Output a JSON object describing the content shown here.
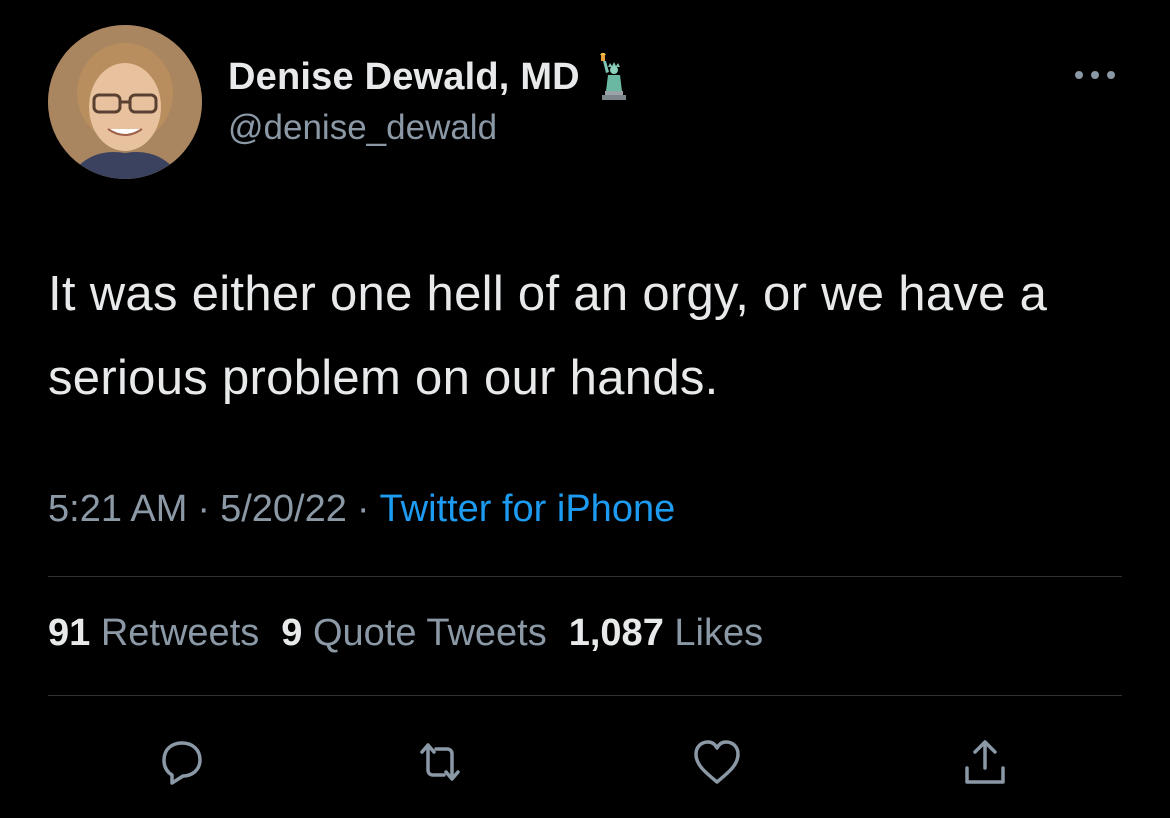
{
  "author": {
    "display_name": "Denise Dewald, MD",
    "handle": "@denise_dewald",
    "emoji_icon": "statue-of-liberty-icon",
    "avatar_icon": "profile-photo"
  },
  "tweet": {
    "text": "It was either one hell of an orgy, or we have a serious problem on our hands.",
    "time": "5:21 AM",
    "date": "5/20/22",
    "separator": "·",
    "source": "Twitter for iPhone"
  },
  "stats": {
    "retweets_count": "91",
    "retweets_label": "Retweets",
    "quotes_count": "9",
    "quotes_label": "Quote Tweets",
    "likes_count": "1,087",
    "likes_label": "Likes"
  },
  "actions": [
    "reply-icon",
    "retweet-icon",
    "like-icon",
    "share-icon"
  ],
  "colors": {
    "background": "#000000",
    "primary_text": "#e7e9ea",
    "secondary_text": "#8b98a5",
    "link": "#1d9bf0",
    "divider": "#2f3336"
  }
}
